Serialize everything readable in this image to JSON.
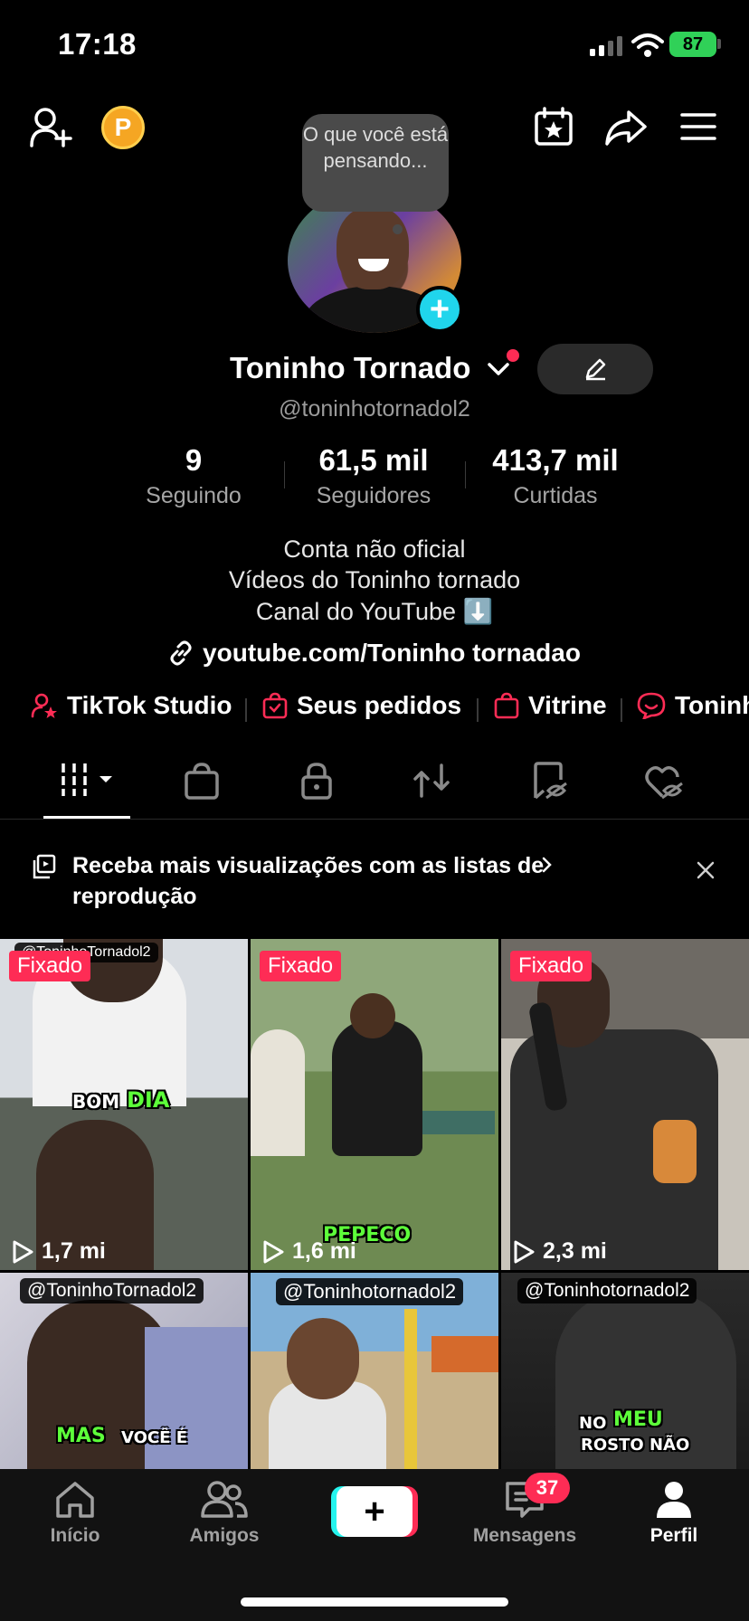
{
  "status_bar": {
    "time": "17:18",
    "battery": "87"
  },
  "top": {
    "coin_letter": "P",
    "thought_bubble": "O que você está pensando..."
  },
  "profile": {
    "name": "Toninho Tornado",
    "handle": "@toninhotornadol2",
    "stats": [
      {
        "value": "9",
        "label": "Seguindo"
      },
      {
        "value": "61,5 mil",
        "label": "Seguidores"
      },
      {
        "value": "413,7 mil",
        "label": "Curtidas"
      }
    ],
    "bio": [
      "Conta não oficial",
      "Vídeos do Toninho tornado",
      "Canal do YouTube ⬇️"
    ],
    "link": "youtube.com/Toninho tornadao"
  },
  "shortcuts": [
    "TikTok Studio",
    "Seus pedidos",
    "Vitrine",
    "Toninh"
  ],
  "promo": {
    "text": "Receba mais visualizações com as listas de reprodução"
  },
  "videos": [
    {
      "pinned": "Fixado",
      "views": "1,7 mi",
      "watermark": "@ToninhoTornadol2",
      "caption_a": "BOM",
      "caption_b": "DIA"
    },
    {
      "pinned": "Fixado",
      "views": "1,6 mi",
      "caption_b": "PEPECO"
    },
    {
      "pinned": "Fixado",
      "views": "2,3 mi"
    },
    {
      "watermark": "@ToninhoTornadol2",
      "caption_a": "VOCÊ É",
      "caption_b": "MAS"
    },
    {
      "watermark": "@Toninhotornadol2"
    },
    {
      "watermark": "@Toninhotornadol2",
      "caption_a": "NO",
      "caption_b": "MEU",
      "caption_c": "ROSTO NÃO"
    }
  ],
  "nav": {
    "home": "Início",
    "friends": "Amigos",
    "create": "+",
    "messages": "Mensagens",
    "messages_badge": "37",
    "profile": "Perfil"
  },
  "colors": {
    "accent": "#fe2c55",
    "cyan": "#20d5ec",
    "caption_green": "#5dff3a"
  }
}
